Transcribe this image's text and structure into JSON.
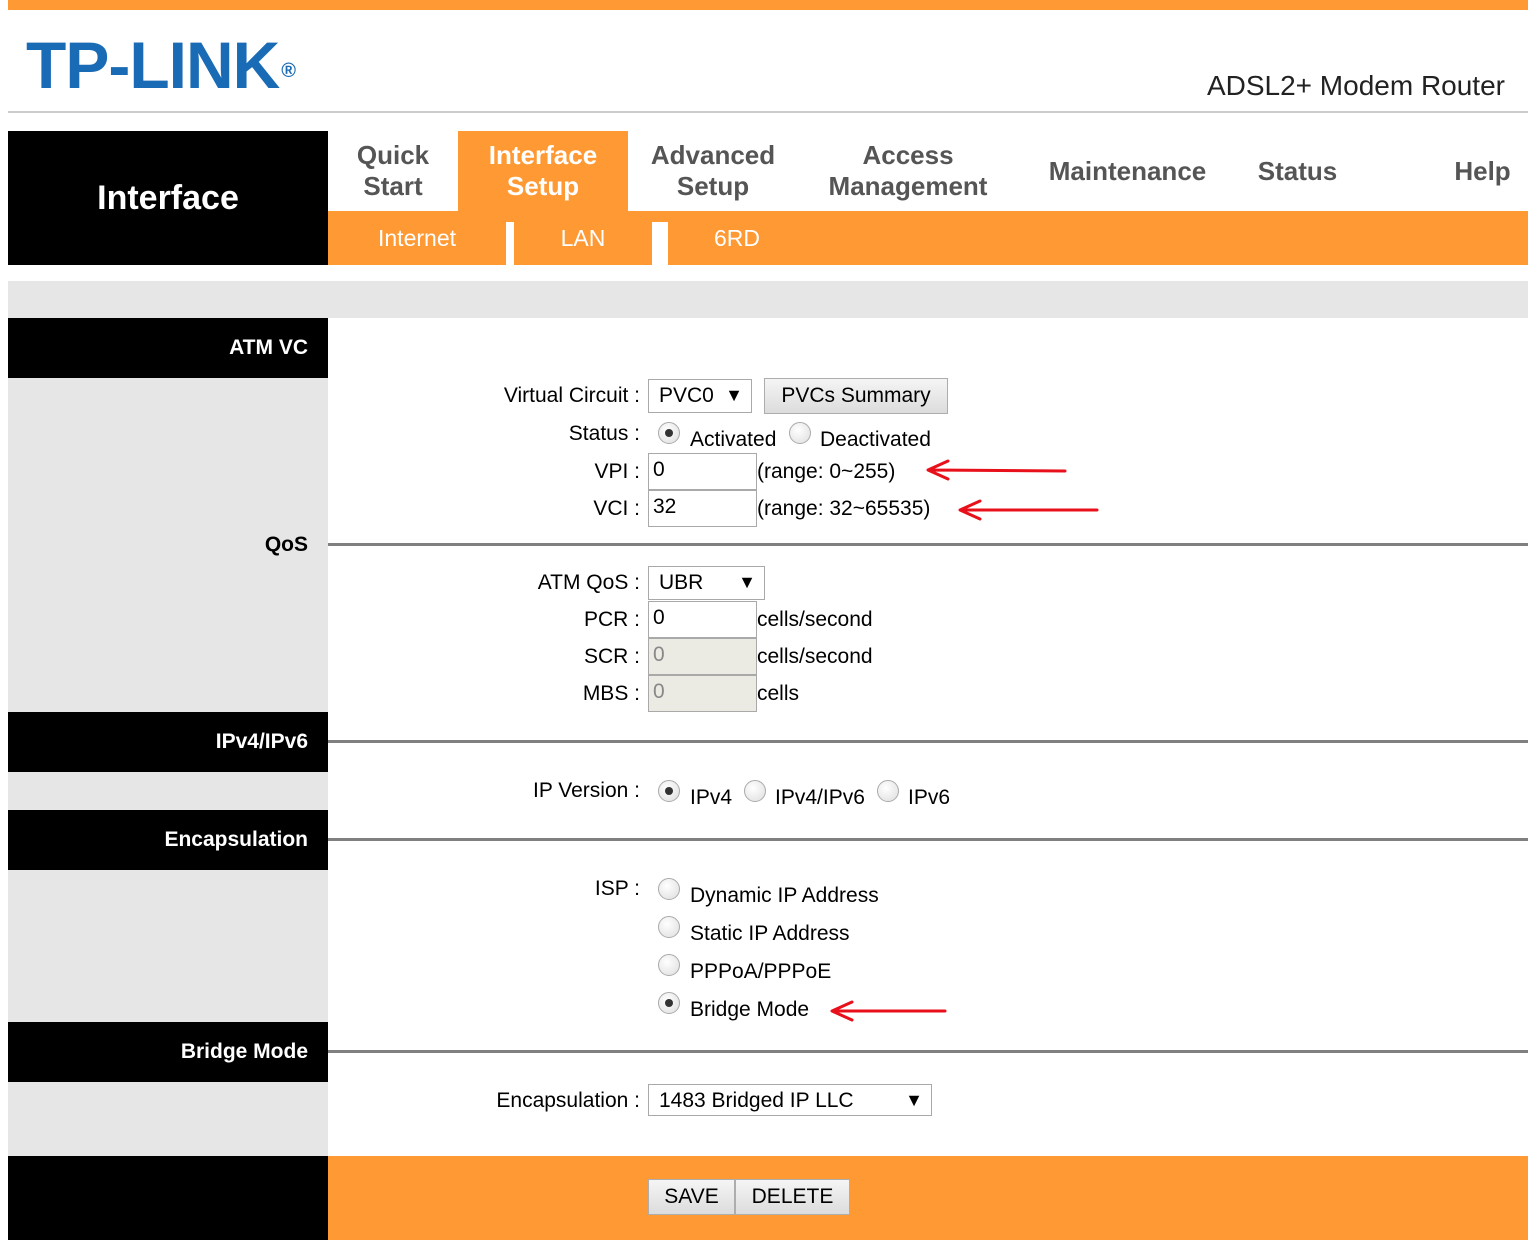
{
  "header": {
    "brand": "TP-LINK",
    "brand_mark": "®",
    "model": "ADSL2+ Modem Router"
  },
  "sidebar_title": "Interface",
  "nav": {
    "items": [
      {
        "label_line1": "Quick",
        "label_line2": "Start"
      },
      {
        "label_line1": "Interface",
        "label_line2": "Setup"
      },
      {
        "label_line1": "Advanced",
        "label_line2": "Setup"
      },
      {
        "label_line1": "Access",
        "label_line2": "Management"
      },
      {
        "label": "Maintenance"
      },
      {
        "label": "Status"
      },
      {
        "label": "Help"
      }
    ],
    "active": "Interface Setup"
  },
  "subnav": {
    "items": [
      "Internet",
      "LAN",
      "6RD"
    ]
  },
  "sections": {
    "atm_vc": "ATM VC",
    "qos": "QoS",
    "ipv4ipv6": "IPv4/IPv6",
    "encapsulation": "Encapsulation",
    "bridge_mode": "Bridge Mode"
  },
  "atm": {
    "virtual_circuit_label": "Virtual Circuit :",
    "virtual_circuit_value": "PVC0",
    "pvcs_summary_button": "PVCs Summary",
    "status_label": "Status :",
    "status_options": [
      "Activated",
      "Deactivated"
    ],
    "status_selected": "Activated",
    "vpi_label": "VPI :",
    "vpi_value": "0",
    "vpi_range": "(range: 0~255)",
    "vci_label": "VCI :",
    "vci_value": "32",
    "vci_range": "(range: 32~65535)"
  },
  "qos": {
    "atm_qos_label": "ATM QoS :",
    "atm_qos_value": "UBR",
    "pcr_label": "PCR :",
    "pcr_value": "0",
    "pcr_unit": "cells/second",
    "scr_label": "SCR :",
    "scr_value": "0",
    "scr_unit": "cells/second",
    "mbs_label": "MBS :",
    "mbs_value": "0",
    "mbs_unit": "cells"
  },
  "ip": {
    "ip_version_label": "IP Version :",
    "options": [
      "IPv4",
      "IPv4/IPv6",
      "IPv6"
    ],
    "selected": "IPv4"
  },
  "isp": {
    "isp_label": "ISP :",
    "options": [
      "Dynamic IP Address",
      "Static IP Address",
      "PPPoA/PPPoE",
      "Bridge Mode"
    ],
    "selected": "Bridge Mode"
  },
  "bridge": {
    "encapsulation_label": "Encapsulation :",
    "encapsulation_value": "1483 Bridged IP LLC"
  },
  "footer": {
    "save_button": "SAVE",
    "delete_button": "DELETE"
  },
  "colors": {
    "accent": "#ff9933",
    "brand": "#1a6bb5",
    "sidebar": "#000000",
    "panel_grey": "#e6e6e6",
    "annotation": "#e8101a"
  }
}
